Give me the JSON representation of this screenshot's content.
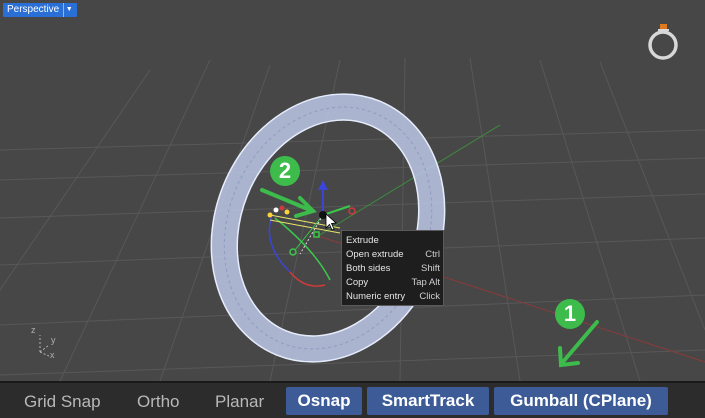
{
  "viewport": {
    "title": "Perspective",
    "dropdown_icon": "caret-down-icon",
    "axis_labels": {
      "z": "z",
      "y": "y",
      "x": "x"
    }
  },
  "context_menu": {
    "items": [
      {
        "label": "Extrude",
        "shortcut": ""
      },
      {
        "label": "Open extrude",
        "shortcut": "Ctrl"
      },
      {
        "label": "Both sides",
        "shortcut": "Shift"
      },
      {
        "label": "Copy",
        "shortcut": "Tap Alt"
      },
      {
        "label": "Numeric entry",
        "shortcut": "Click"
      }
    ]
  },
  "annotations": {
    "badge_1": "1",
    "badge_2": "2"
  },
  "statusbar": {
    "grid_snap": "Grid Snap",
    "ortho": "Ortho",
    "planar": "Planar",
    "osnap": "Osnap",
    "smarttrack": "SmartTrack",
    "gumball": "Gumball (CPlane)"
  },
  "colors": {
    "viewport_bg": "#474747",
    "active_toggle": "#3d5c97",
    "annotation_green": "#3dbb4b",
    "tab_blue": "#2a6fd6"
  }
}
